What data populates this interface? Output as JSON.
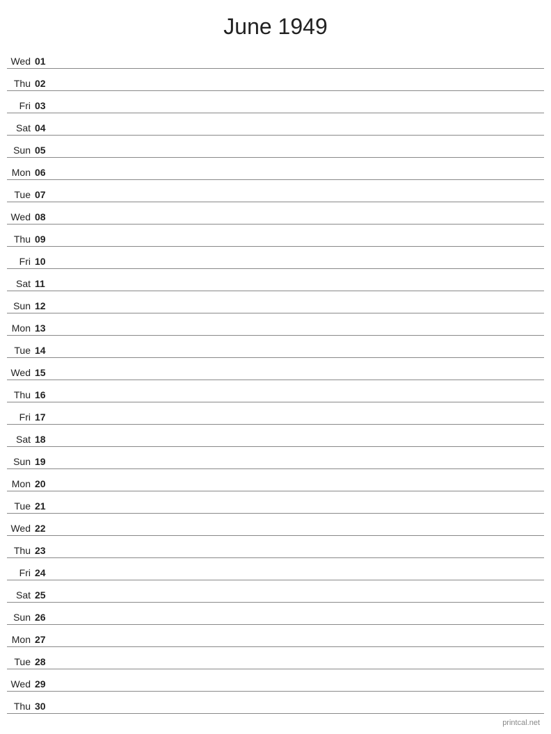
{
  "title": "June 1949",
  "footer": "printcal.net",
  "days": [
    {
      "name": "Wed",
      "number": "01"
    },
    {
      "name": "Thu",
      "number": "02"
    },
    {
      "name": "Fri",
      "number": "03"
    },
    {
      "name": "Sat",
      "number": "04"
    },
    {
      "name": "Sun",
      "number": "05"
    },
    {
      "name": "Mon",
      "number": "06"
    },
    {
      "name": "Tue",
      "number": "07"
    },
    {
      "name": "Wed",
      "number": "08"
    },
    {
      "name": "Thu",
      "number": "09"
    },
    {
      "name": "Fri",
      "number": "10"
    },
    {
      "name": "Sat",
      "number": "11"
    },
    {
      "name": "Sun",
      "number": "12"
    },
    {
      "name": "Mon",
      "number": "13"
    },
    {
      "name": "Tue",
      "number": "14"
    },
    {
      "name": "Wed",
      "number": "15"
    },
    {
      "name": "Thu",
      "number": "16"
    },
    {
      "name": "Fri",
      "number": "17"
    },
    {
      "name": "Sat",
      "number": "18"
    },
    {
      "name": "Sun",
      "number": "19"
    },
    {
      "name": "Mon",
      "number": "20"
    },
    {
      "name": "Tue",
      "number": "21"
    },
    {
      "name": "Wed",
      "number": "22"
    },
    {
      "name": "Thu",
      "number": "23"
    },
    {
      "name": "Fri",
      "number": "24"
    },
    {
      "name": "Sat",
      "number": "25"
    },
    {
      "name": "Sun",
      "number": "26"
    },
    {
      "name": "Mon",
      "number": "27"
    },
    {
      "name": "Tue",
      "number": "28"
    },
    {
      "name": "Wed",
      "number": "29"
    },
    {
      "name": "Thu",
      "number": "30"
    }
  ]
}
